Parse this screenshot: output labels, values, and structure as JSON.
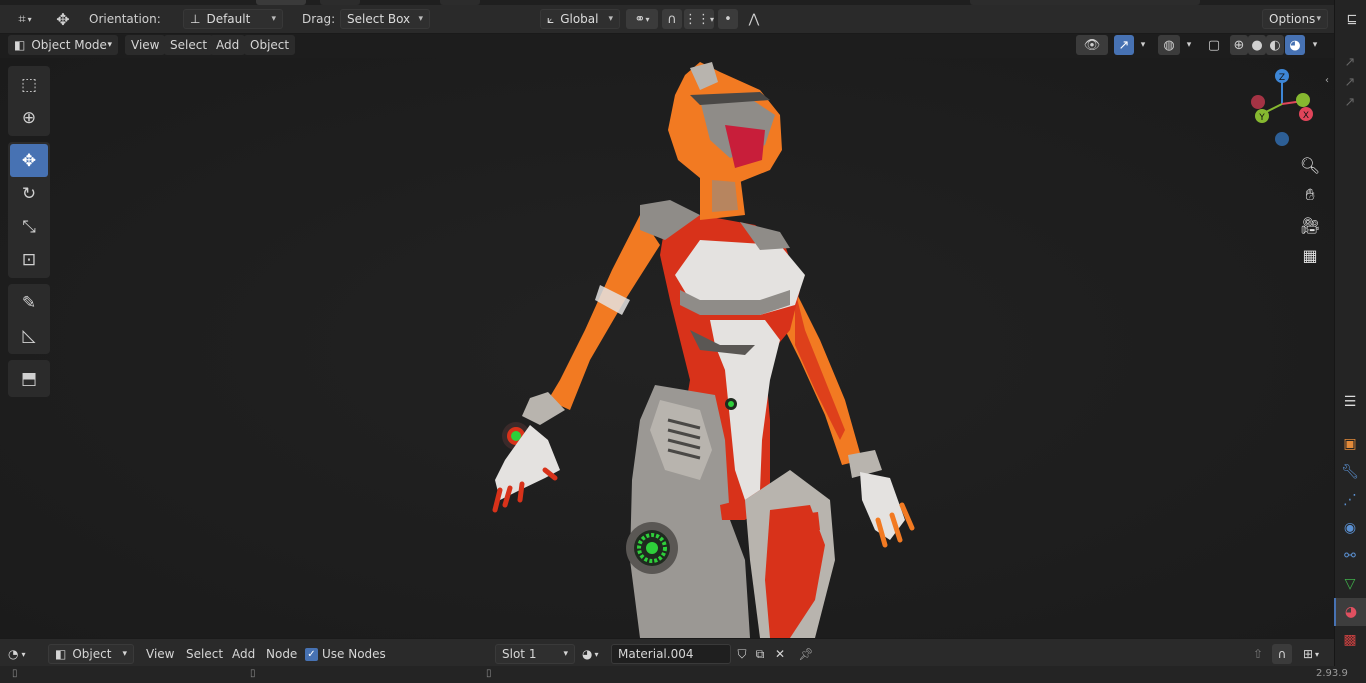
{
  "header": {
    "orientation_label": "Orientation:",
    "orientation_value": "Default",
    "drag_label": "Drag:",
    "drag_value": "Select Box",
    "transform_space": "Global",
    "options_label": "Options"
  },
  "viewport_header": {
    "mode": "Object Mode",
    "menus": [
      "View",
      "Select",
      "Add",
      "Object"
    ]
  },
  "toolbar": {
    "tools": [
      {
        "name": "select-box-icon",
        "glyph": "⬚",
        "active": false
      },
      {
        "name": "cursor-icon",
        "glyph": "⊕",
        "active": false
      },
      {
        "name": "move-icon",
        "glyph": "✥",
        "active": true
      },
      {
        "name": "rotate-icon",
        "glyph": "↻",
        "active": false
      },
      {
        "name": "scale-icon",
        "glyph": "⤡",
        "active": false
      },
      {
        "name": "transform-icon",
        "glyph": "⊡",
        "active": false
      },
      {
        "name": "annotate-icon",
        "glyph": "✎",
        "active": false
      },
      {
        "name": "measure-icon",
        "glyph": "📐",
        "active": false
      },
      {
        "name": "add-cube-icon",
        "glyph": "⬒",
        "active": false
      }
    ]
  },
  "gizmo": {
    "x": "X",
    "y": "Y",
    "z": "Z"
  },
  "shader_editor": {
    "editor_type": "Object",
    "menus": [
      "View",
      "Select",
      "Add",
      "Node"
    ],
    "use_nodes_label": "Use Nodes",
    "use_nodes_checked": true,
    "slot": "Slot 1",
    "material_name": "Material.004"
  },
  "status": {
    "version": "2.93.9"
  },
  "colors": {
    "accent": "#4772b3",
    "suit_orange": "#f27a22",
    "suit_red": "#d8321a",
    "suit_white": "#e4e2e0",
    "suit_grey": "#8f8c88",
    "lens_green": "#2ecf3a",
    "gizmo_x": "#e0455a",
    "gizmo_y": "#86b830",
    "gizmo_z": "#3d86d6"
  }
}
